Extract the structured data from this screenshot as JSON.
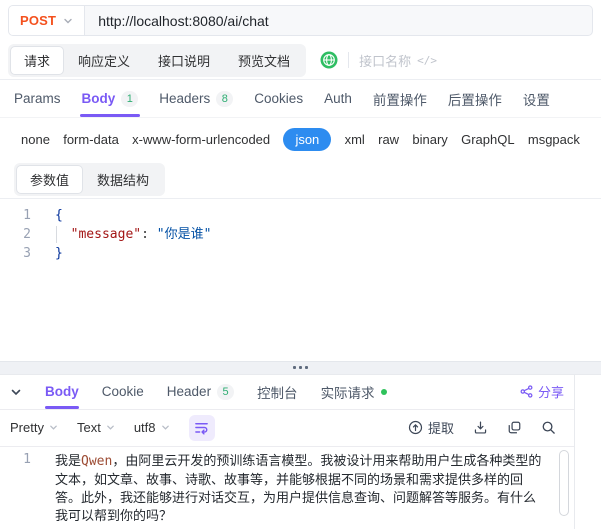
{
  "request_bar": {
    "method": "POST",
    "url": "http://localhost:8080/ai/chat"
  },
  "view_tabs": {
    "items": [
      {
        "label": "请求"
      },
      {
        "label": "响应定义"
      },
      {
        "label": "接口说明"
      },
      {
        "label": "预览文档"
      }
    ],
    "api_name_placeholder": "接口名称",
    "code_icon": "</>"
  },
  "request_tabs": {
    "items": [
      {
        "label": "Params",
        "badge": ""
      },
      {
        "label": "Body",
        "badge": "1"
      },
      {
        "label": "Headers",
        "badge": "8"
      },
      {
        "label": "Cookies",
        "badge": ""
      },
      {
        "label": "Auth",
        "badge": ""
      },
      {
        "label": "前置操作",
        "badge": ""
      },
      {
        "label": "后置操作",
        "badge": ""
      },
      {
        "label": "设置",
        "badge": ""
      }
    ],
    "active": "Body"
  },
  "body_types": {
    "items": [
      "none",
      "form-data",
      "x-www-form-urlencoded",
      "json",
      "xml",
      "raw",
      "binary",
      "GraphQL",
      "msgpack"
    ],
    "active": "json"
  },
  "body_view_tabs": {
    "items": [
      {
        "label": "参数值"
      },
      {
        "label": "数据结构"
      }
    ],
    "active": "参数值"
  },
  "request_editor": {
    "line_numbers": [
      "1",
      "2",
      "3"
    ],
    "code": {
      "open_brace": "{",
      "indent": "  ",
      "key": "\"message\"",
      "colon": ": ",
      "value": "\"你是谁\"",
      "close_brace": "}"
    }
  },
  "response_tabs": {
    "items": [
      {
        "label": "Body",
        "badge": ""
      },
      {
        "label": "Cookie",
        "badge": ""
      },
      {
        "label": "Header",
        "badge": "5"
      },
      {
        "label": "控制台",
        "badge": ""
      },
      {
        "label": "实际请求",
        "badge": ""
      }
    ],
    "active": "Body",
    "share_label": "分享"
  },
  "response_toolbar": {
    "format_select": "Pretty",
    "type_select": "Text",
    "encoding_select": "utf8",
    "extract_label": "提取"
  },
  "response_content": {
    "line_number": "1",
    "text_before": "我是",
    "model_name": "Qwen",
    "text_after": "，由阿里云开发的预训练语言模型。我被设计用来帮助用户生成各种类型的文本，如文章、故事、诗歌、故事等，并能够根据不同的场景和需求提供多样的回答。此外，我还能够进行对话交互，为用户提供信息查询、问题解答等服务。有什么我可以帮到你的吗？"
  },
  "colors": {
    "accent_purple": "#7a5af5",
    "method_orange": "#f4511e",
    "active_blue": "#2d8cf0",
    "badge_green": "#2fae73",
    "status_green": "#2fc25b",
    "json_key": "#a31515",
    "json_value": "#0451a5"
  }
}
